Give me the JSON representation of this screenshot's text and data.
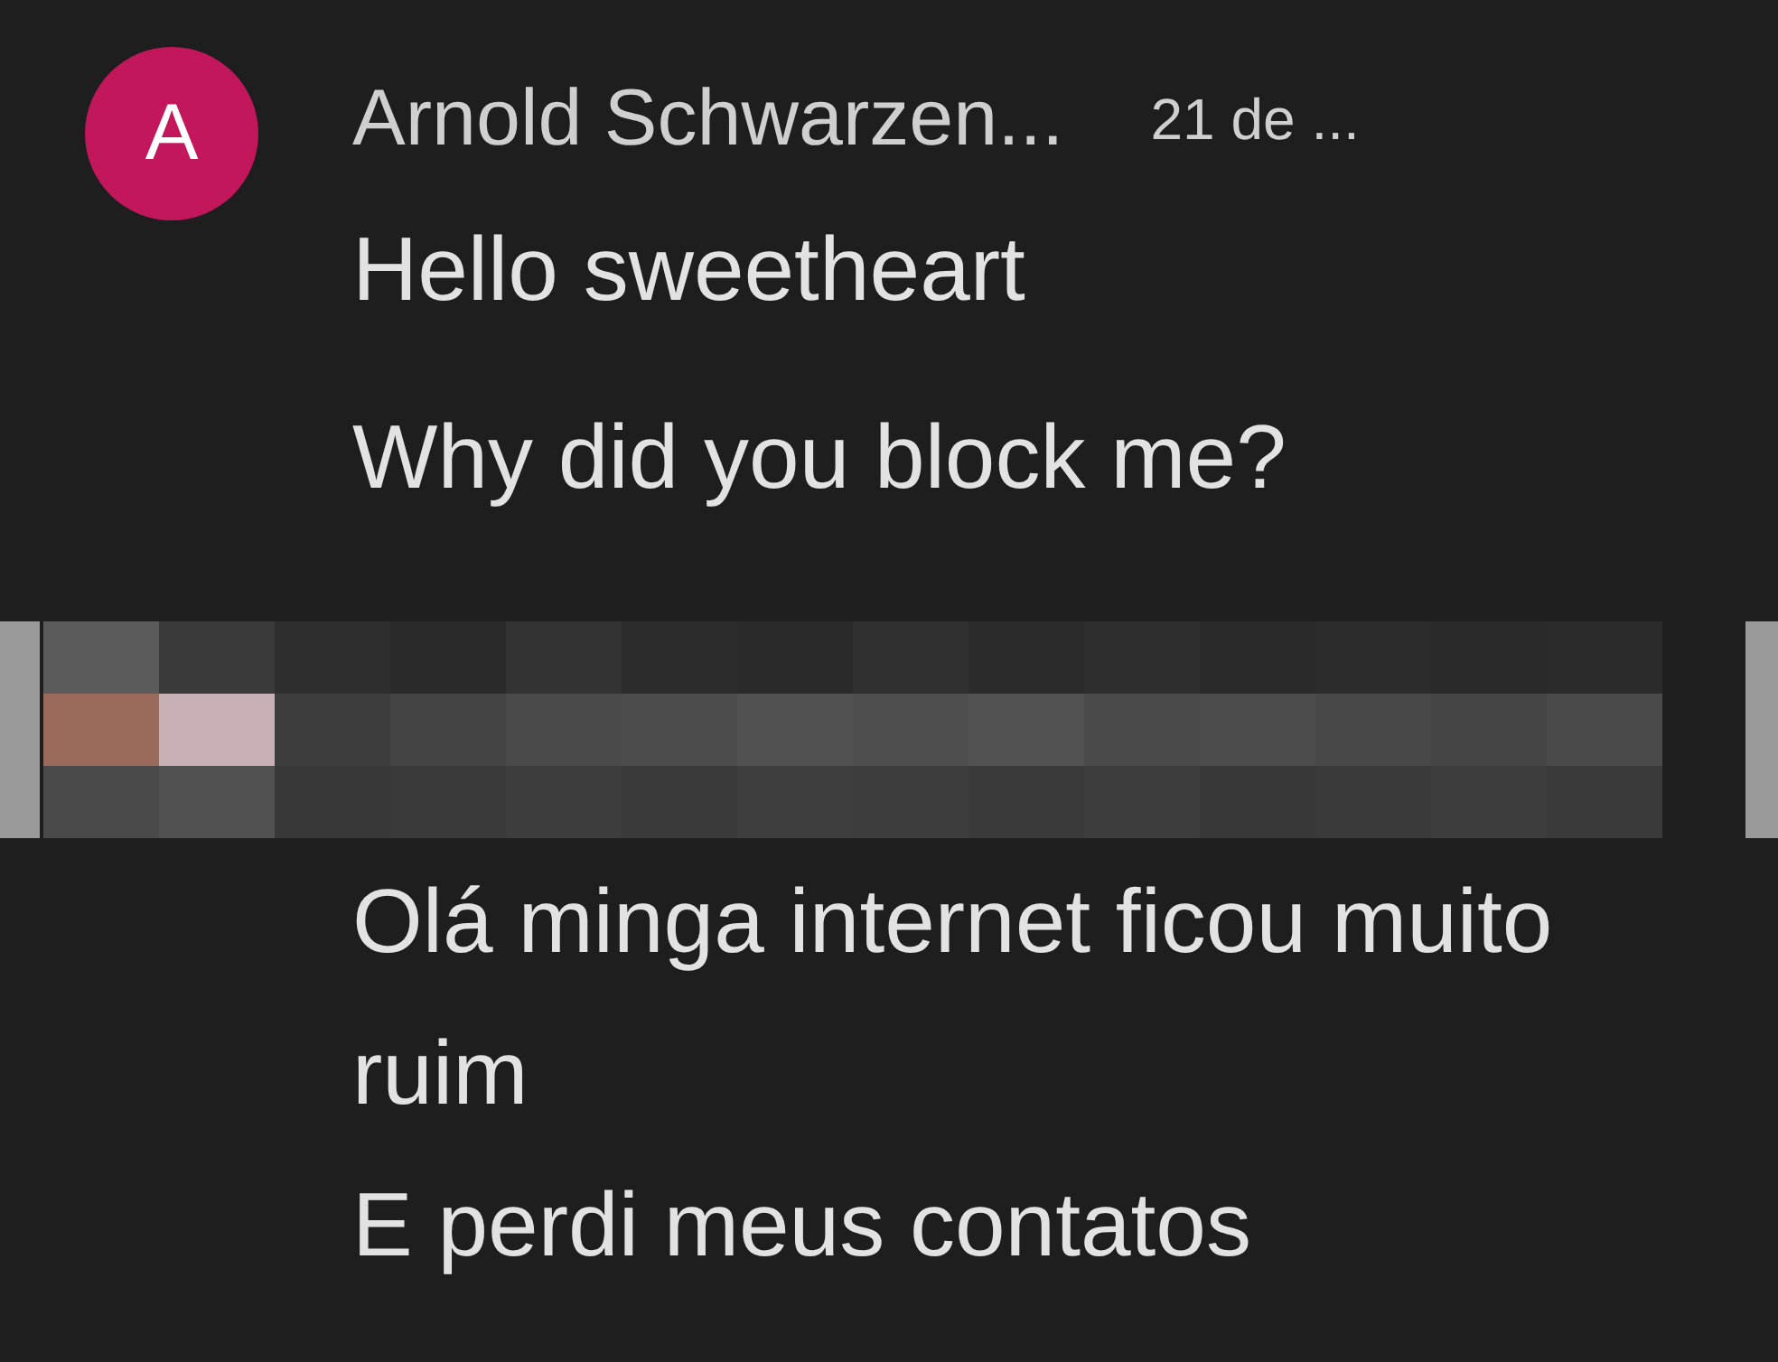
{
  "sender": {
    "avatar_letter": "A",
    "name": "Arnold Schwarzen...",
    "date": "21 de ..."
  },
  "messages_before": [
    "Hello sweetheart",
    "Why did you block me?"
  ],
  "messages_after": [
    "Olá minga internet ficou muito ruim",
    "E perdi meus contatos"
  ]
}
